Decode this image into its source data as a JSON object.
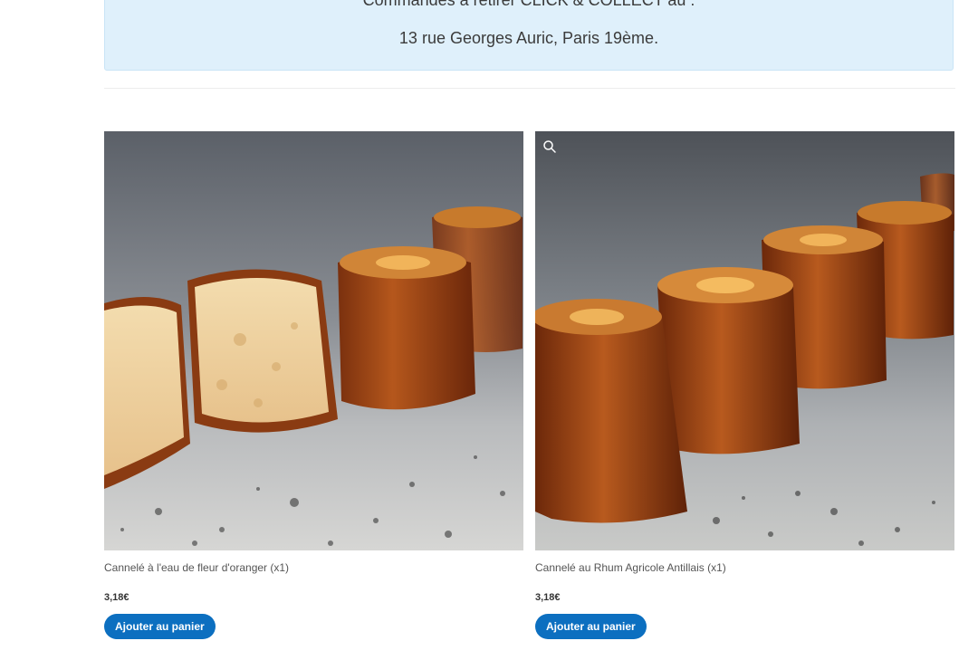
{
  "notice": {
    "line1": "Commandes à retirer CLICK & COLLECT au :",
    "line2": "13 rue Georges Auric, Paris 19ème."
  },
  "products": [
    {
      "title": "Cannelé à l'eau de fleur d'oranger (x1)",
      "price": "3,18€",
      "button_label": "Ajouter au panier",
      "image_alt": "Cannelés sur plan de travail en granit"
    },
    {
      "title": "Cannelé au Rhum Agricole Antillais (x1)",
      "price": "3,18€",
      "button_label": "Ajouter au panier",
      "image_alt": "Cannelés sur plan de travail en granit",
      "zoom_icon": "search-icon"
    }
  ],
  "colors": {
    "notice_bg": "#dff0fb",
    "button_bg": "#0c6fc0",
    "button_text": "#ffffff"
  }
}
